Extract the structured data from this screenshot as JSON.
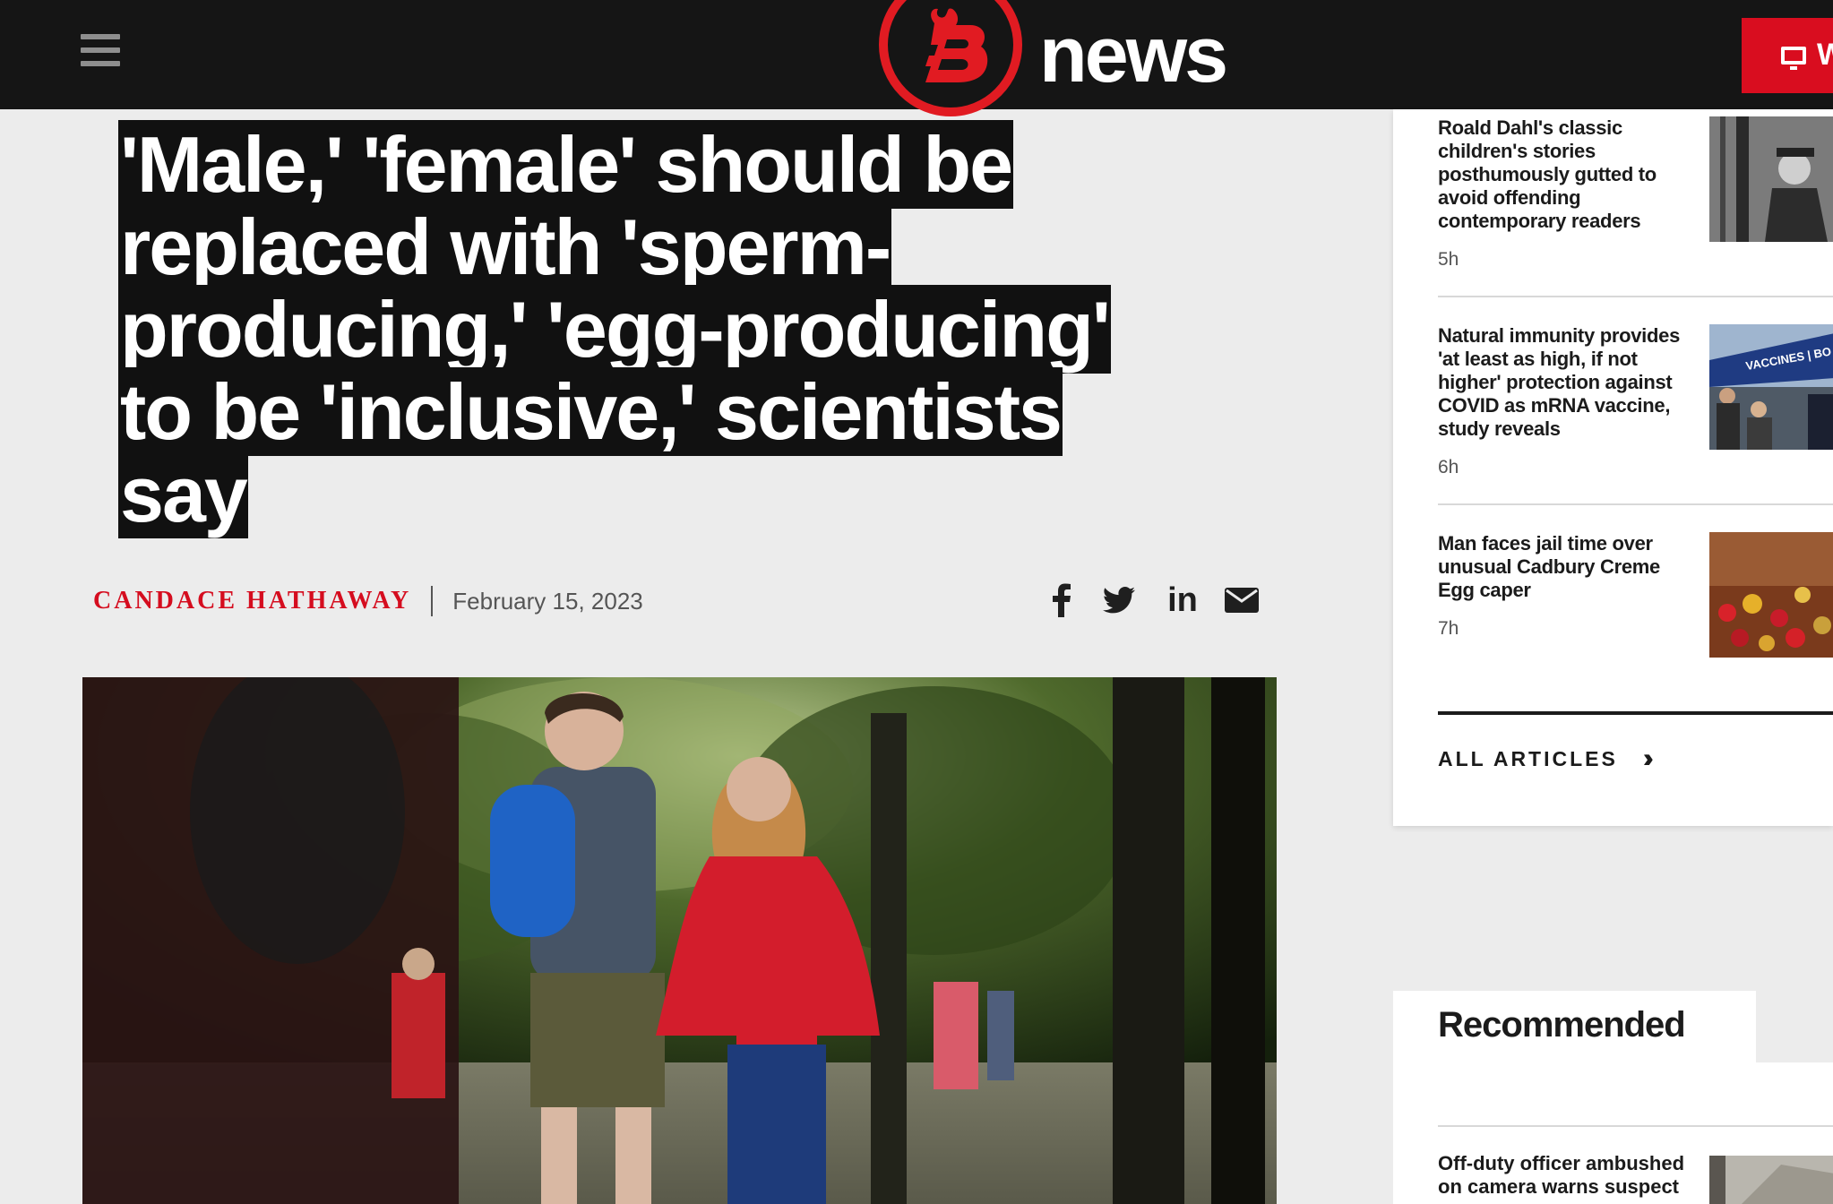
{
  "header": {
    "brand": "news",
    "watch_label": "W"
  },
  "article": {
    "headline": "'Male,' 'female' should be replaced with 'sperm-producing,' 'egg-producing' to be 'inclusive,' scientists say",
    "author": "CANDACE HATHAWAY",
    "date": "February 15, 2023",
    "share": [
      "facebook-icon",
      "twitter-icon",
      "linkedin-icon",
      "email-icon"
    ],
    "linkedin_label": "in"
  },
  "sidebar": {
    "articles": [
      {
        "title": "Roald Dahl's classic children's stories posthumously gutted to avoid offending contemporary readers",
        "time": "5h"
      },
      {
        "title": "Natural immunity provides 'at least as high, if not higher' protection against COVID as mRNA vaccine, study reveals",
        "time": "6h",
        "thumb_sign": "VACCINES | BO"
      },
      {
        "title": "Man faces jail time over unusual Cadbury Creme Egg caper",
        "time": "7h"
      }
    ],
    "all_articles_label": "ALL ARTICLES",
    "all_articles_icon": "double-chevron-right-icon"
  },
  "recommended": {
    "title": "Recommended",
    "items": [
      {
        "title": "Off-duty officer ambushed on camera warns suspect"
      }
    ]
  },
  "colors": {
    "brand_red": "#e11b22",
    "author_red": "#d50d1f",
    "topbar": "#151515",
    "page_bg": "#ececec"
  }
}
